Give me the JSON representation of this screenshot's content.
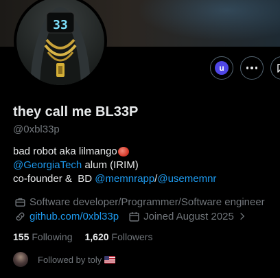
{
  "profile": {
    "display_name": "they call me BL33P",
    "handle": "@0xbl33p",
    "avatar_display_text": "33",
    "bio": {
      "line1_text": "bad robot aka lilmango",
      "line2_link": "@GeorgiaTech",
      "line2_text": " alum (IRIM)",
      "line3_text": "co-founder &  BD ",
      "line3_link1": "@memnrapp",
      "line3_sep": "/",
      "line3_link2": "@usememnr"
    },
    "category": "Software developer/Programmer/Software engineer",
    "website": "github.com/0xbl33p",
    "joined": "Joined August 2025",
    "following_count": "155",
    "following_label": "Following",
    "followers_count": "1,620",
    "followers_label": "Followers",
    "followed_by_prefix": "Followed by ",
    "followed_by_name": "toly"
  },
  "actions": {
    "user_badge_letter": "u"
  },
  "colors": {
    "background": "#000000",
    "primary_text": "#e7e9ea",
    "secondary_text": "#71767b",
    "link": "#1d9bf0",
    "button_border": "#536471",
    "user_badge": "#4f46e5"
  },
  "icons": {
    "more": "more-icon",
    "message": "message-icon",
    "briefcase": "briefcase-icon",
    "link": "link-icon",
    "calendar": "calendar-icon",
    "chevron": "chevron-right-icon",
    "emoji": "mango-emoji-icon",
    "flag": "us-flag-icon"
  }
}
